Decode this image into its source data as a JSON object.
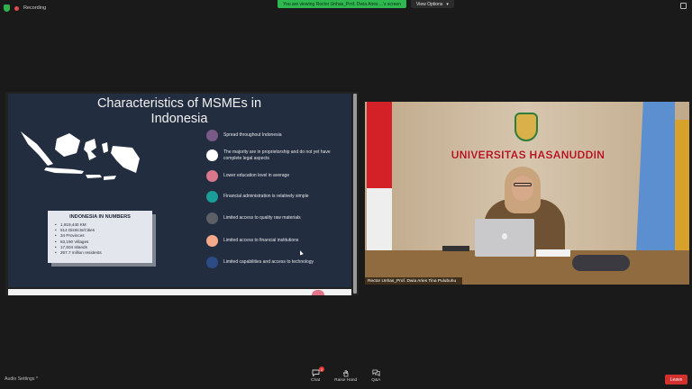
{
  "top": {
    "recording_label": "Recording",
    "banner_text": "You are viewing Rector Unhas_Prof. Dwia Aries ...'s screen",
    "view_options_label": "View Options",
    "view_options_caret": "▾"
  },
  "slide": {
    "title": "Characteristics of MSMEs in Indonesia",
    "numbers_title": "INDONESIA IN NUMBERS",
    "numbers": [
      "1,919,440 KM",
      "514 Districts/Cities",
      "34 Provinces",
      "83,190 Villages",
      "17,504 Islands",
      "267.7 million residents"
    ],
    "items": [
      {
        "text": "Spread throughout Indonesia",
        "color": "#7a5a86"
      },
      {
        "text": "The majority are in proprietorship and do not yet have complete legal aspects",
        "color": "#ffffff"
      },
      {
        "text": "Lower education level in average",
        "color": "#d9788a"
      },
      {
        "text": "Financial administration is relatively simple",
        "color": "#1b9e9a"
      },
      {
        "text": "Limited access to quality raw materials",
        "color": "#5c5f66"
      },
      {
        "text": "Limited access to financial institutions",
        "color": "#f3a98a"
      },
      {
        "text": "Limited capabilities and access to technology",
        "color": "#2d4c86"
      }
    ]
  },
  "video": {
    "university_name": "UNIVERSITAS HASANUDDIN",
    "participant_name": "Rector Unhas_Prof. Dwia Aries Tina Pulubuhu"
  },
  "bottom": {
    "audio_settings_label": "Audio Settings",
    "audio_caret": "^",
    "tools": [
      {
        "name": "chat",
        "label": "Chat",
        "icon": "chat-icon",
        "badge": "2"
      },
      {
        "name": "raise-hand",
        "label": "Raise Hand",
        "icon": "hand-icon"
      },
      {
        "name": "qa",
        "label": "Q&A",
        "icon": "qa-icon"
      }
    ],
    "leave_label": "Leave"
  },
  "colors": {
    "banner_green": "#2eb84f",
    "leave_red": "#d3312e",
    "slide_bg": "#222d3f"
  }
}
